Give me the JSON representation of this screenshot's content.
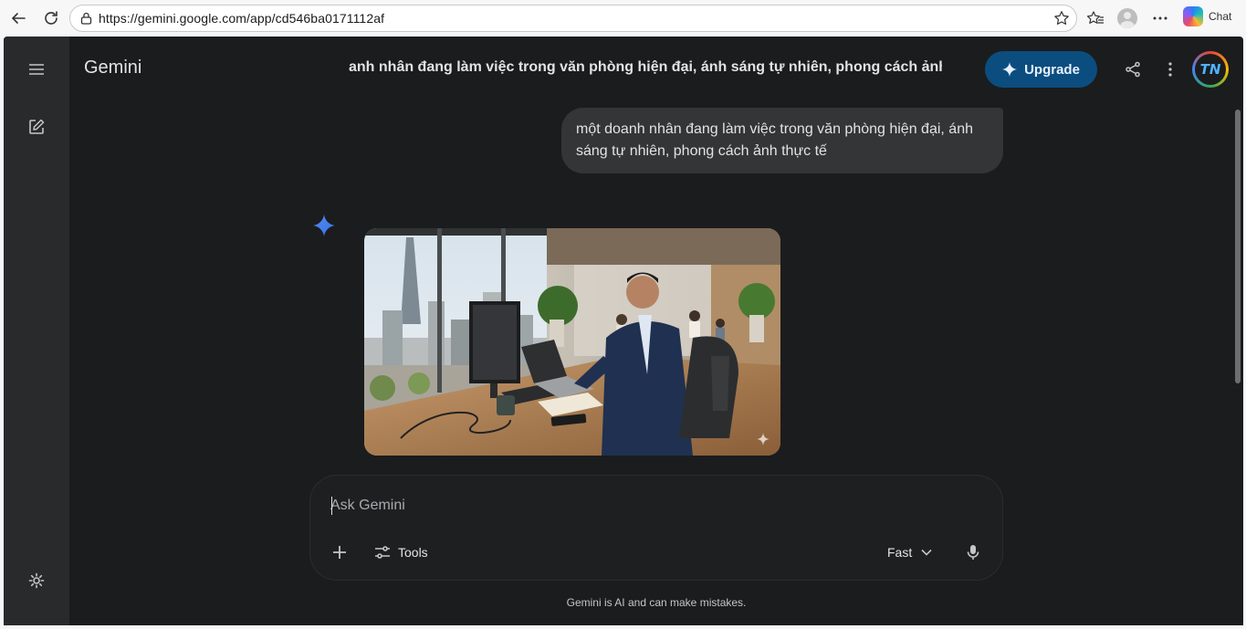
{
  "browser": {
    "url": "https://gemini.google.com/app/cd546ba0171112af",
    "copilot_label": "Chat"
  },
  "app": {
    "name": "Gemini",
    "chat_title": "anh nhân đang làm việc trong văn phòng hiện đại, ánh sáng tự nhiên, phong cách ảnh",
    "upgrade_label": "Upgrade",
    "avatar_initials": "TN"
  },
  "conversation": {
    "user_message": "một doanh nhân đang làm việc trong văn phòng hiện đại, ánh sáng tự nhiên, phong cách ảnh thực tế",
    "response_icon": "gemini-spark-icon",
    "response_image": "generated-office-photo"
  },
  "composer": {
    "placeholder": "Ask Gemini",
    "tools_label": "Tools",
    "model_label": "Fast"
  },
  "footer": {
    "disclaimer": "Gemini is AI and can make mistakes."
  },
  "colors": {
    "background": "#1b1c1d",
    "sidebar": "#282a2c",
    "upgrade": "#0b4d7f",
    "bubble": "#333537",
    "accent": "#4285f4"
  }
}
